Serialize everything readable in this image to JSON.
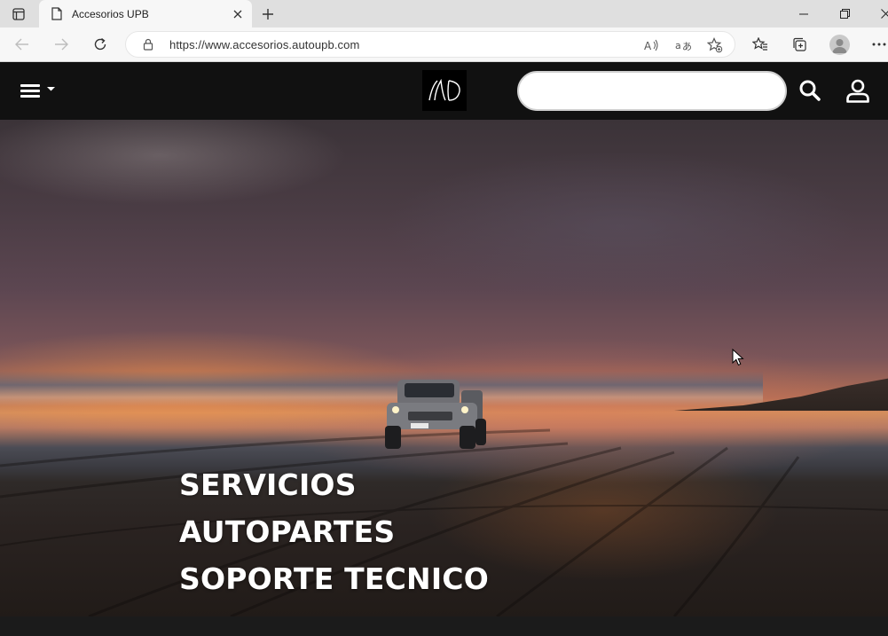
{
  "browser": {
    "tab": {
      "title": "Accesorios UPB"
    },
    "url": "https://www.accesorios.autoupb.com"
  },
  "site": {
    "search": {
      "placeholder": ""
    },
    "hero_menu": [
      "SERVICIOS",
      "AUTOPARTES",
      "SOPORTE TECNICO"
    ]
  },
  "icons": {
    "tab_actions": "tab-actions-icon",
    "favicon": "page-icon",
    "menu": "hamburger-icon",
    "logo": "brand-logo",
    "search": "search-icon",
    "user": "user-icon"
  }
}
